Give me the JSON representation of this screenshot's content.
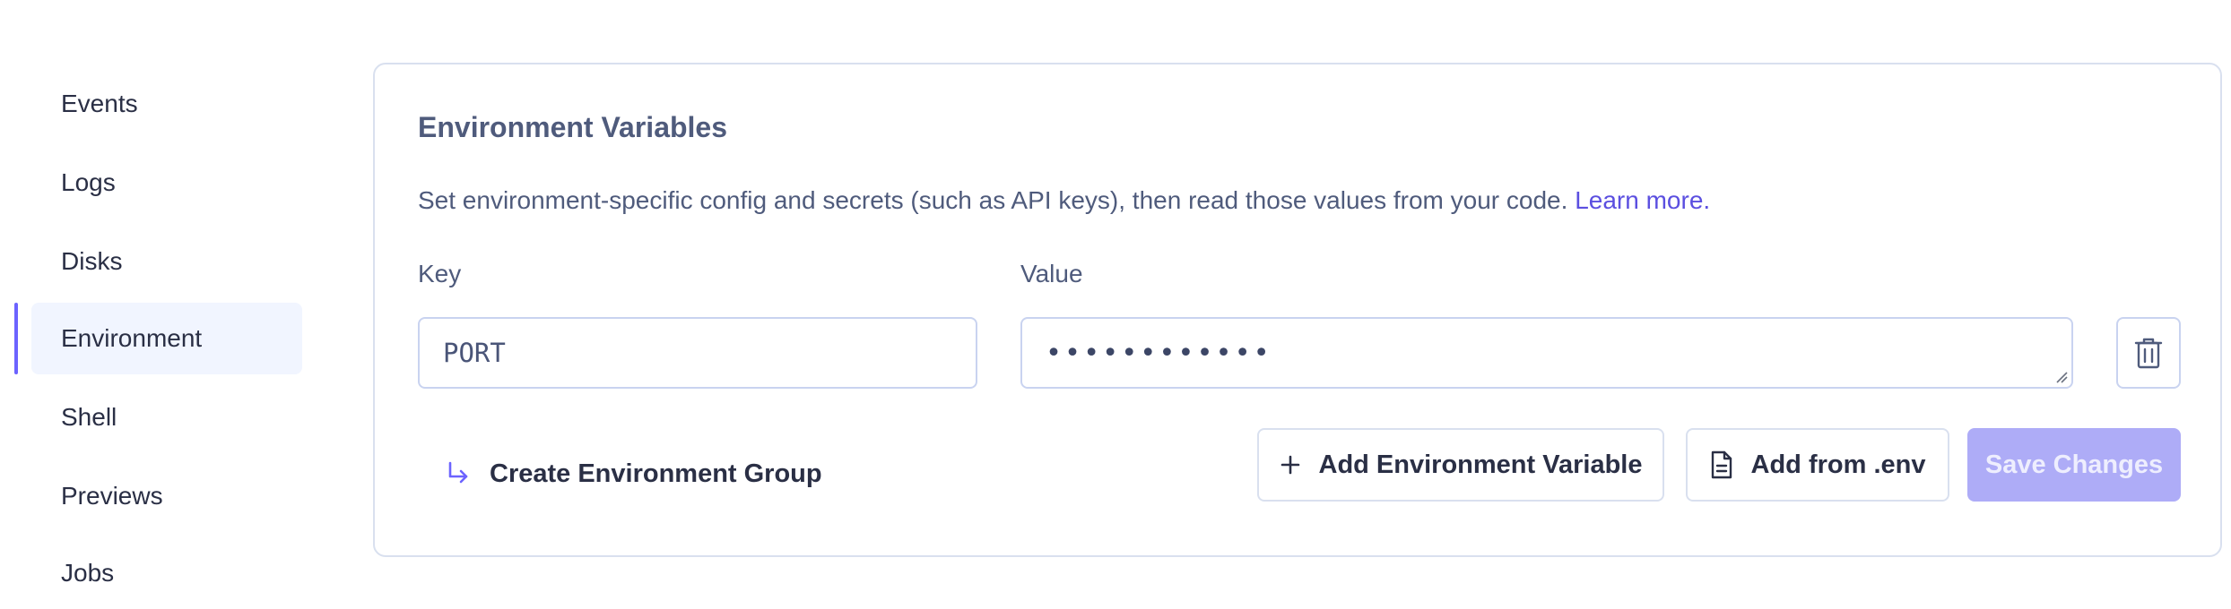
{
  "sidebar": {
    "items": [
      {
        "label": "Events"
      },
      {
        "label": "Logs"
      },
      {
        "label": "Disks"
      },
      {
        "label": "Environment",
        "active": true
      },
      {
        "label": "Shell"
      },
      {
        "label": "Previews"
      },
      {
        "label": "Jobs"
      }
    ]
  },
  "env": {
    "title": "Environment Variables",
    "description": "Set environment-specific config and secrets (such as API keys), then read those values from your code.",
    "learn_more": "Learn more.",
    "key_label": "Key",
    "value_label": "Value",
    "row": {
      "key": "PORT",
      "value_masked": "••••••••••••"
    },
    "create_group_label": "Create Environment Group",
    "add_variable_label": "Add Environment Variable",
    "add_from_env_label": "Add from .env",
    "save_label": "Save Changes"
  },
  "icons": {
    "delete": "trash-icon",
    "create_group": "return-arrow-icon",
    "add": "plus-icon",
    "file": "file-icon"
  },
  "colors": {
    "accent": "#6c63ff",
    "link": "#5b4fe0",
    "save_disabled_bg": "#aeacf7",
    "active_nav_bg": "#f1f5ff"
  }
}
